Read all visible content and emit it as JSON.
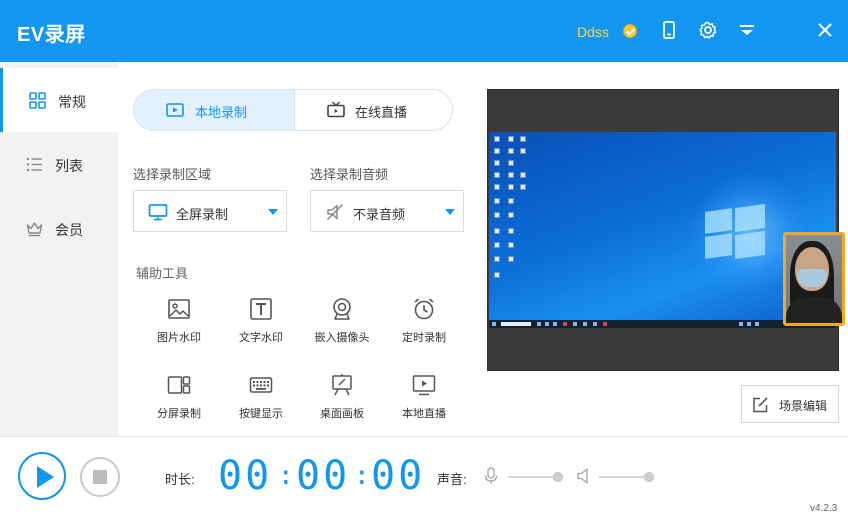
{
  "app": {
    "title": "EV录屏",
    "version": "v4.2.3"
  },
  "titlebar": {
    "user_name": "Ddss",
    "icons": [
      "vip-badge-icon",
      "phone-icon",
      "gear-icon",
      "menu-icon",
      "close-icon"
    ]
  },
  "sidebar": {
    "items": [
      {
        "label": "常规",
        "icon": "grid-icon",
        "active": true
      },
      {
        "label": "列表",
        "icon": "list-icon",
        "active": false
      },
      {
        "label": "会员",
        "icon": "crown-icon",
        "active": false
      }
    ]
  },
  "mode_tabs": {
    "local_label": "本地录制",
    "live_label": "在线直播",
    "selected": "本地录制"
  },
  "record_area": {
    "label": "选择录制区域",
    "value": "全屏录制"
  },
  "record_audio": {
    "label": "选择录制音频",
    "value": "不录音频"
  },
  "tools": {
    "label": "辅助工具",
    "items": [
      {
        "label": "图片水印",
        "icon": "image-icon"
      },
      {
        "label": "文字水印",
        "icon": "text-icon"
      },
      {
        "label": "嵌入摄像头",
        "icon": "camera-icon"
      },
      {
        "label": "定时录制",
        "icon": "alarm-clock-icon"
      },
      {
        "label": "分屏录制",
        "icon": "split-screen-icon"
      },
      {
        "label": "按键显示",
        "icon": "keyboard-icon"
      },
      {
        "label": "桌面画板",
        "icon": "easel-icon"
      },
      {
        "label": "本地直播",
        "icon": "monitor-play-icon"
      }
    ]
  },
  "preview": {
    "scene_button_label": "场景编辑"
  },
  "bottom": {
    "duration_label": "时长:",
    "timer": {
      "hours": "00",
      "minutes": "00",
      "seconds": "00",
      "separator": ":"
    },
    "sound_label": "声音:",
    "mic_volume": 0.85,
    "speaker_volume": 0.85
  },
  "colors": {
    "accent": "#1296f0",
    "webcam_border": "#f5a623",
    "user_name": "#ffd54a"
  }
}
